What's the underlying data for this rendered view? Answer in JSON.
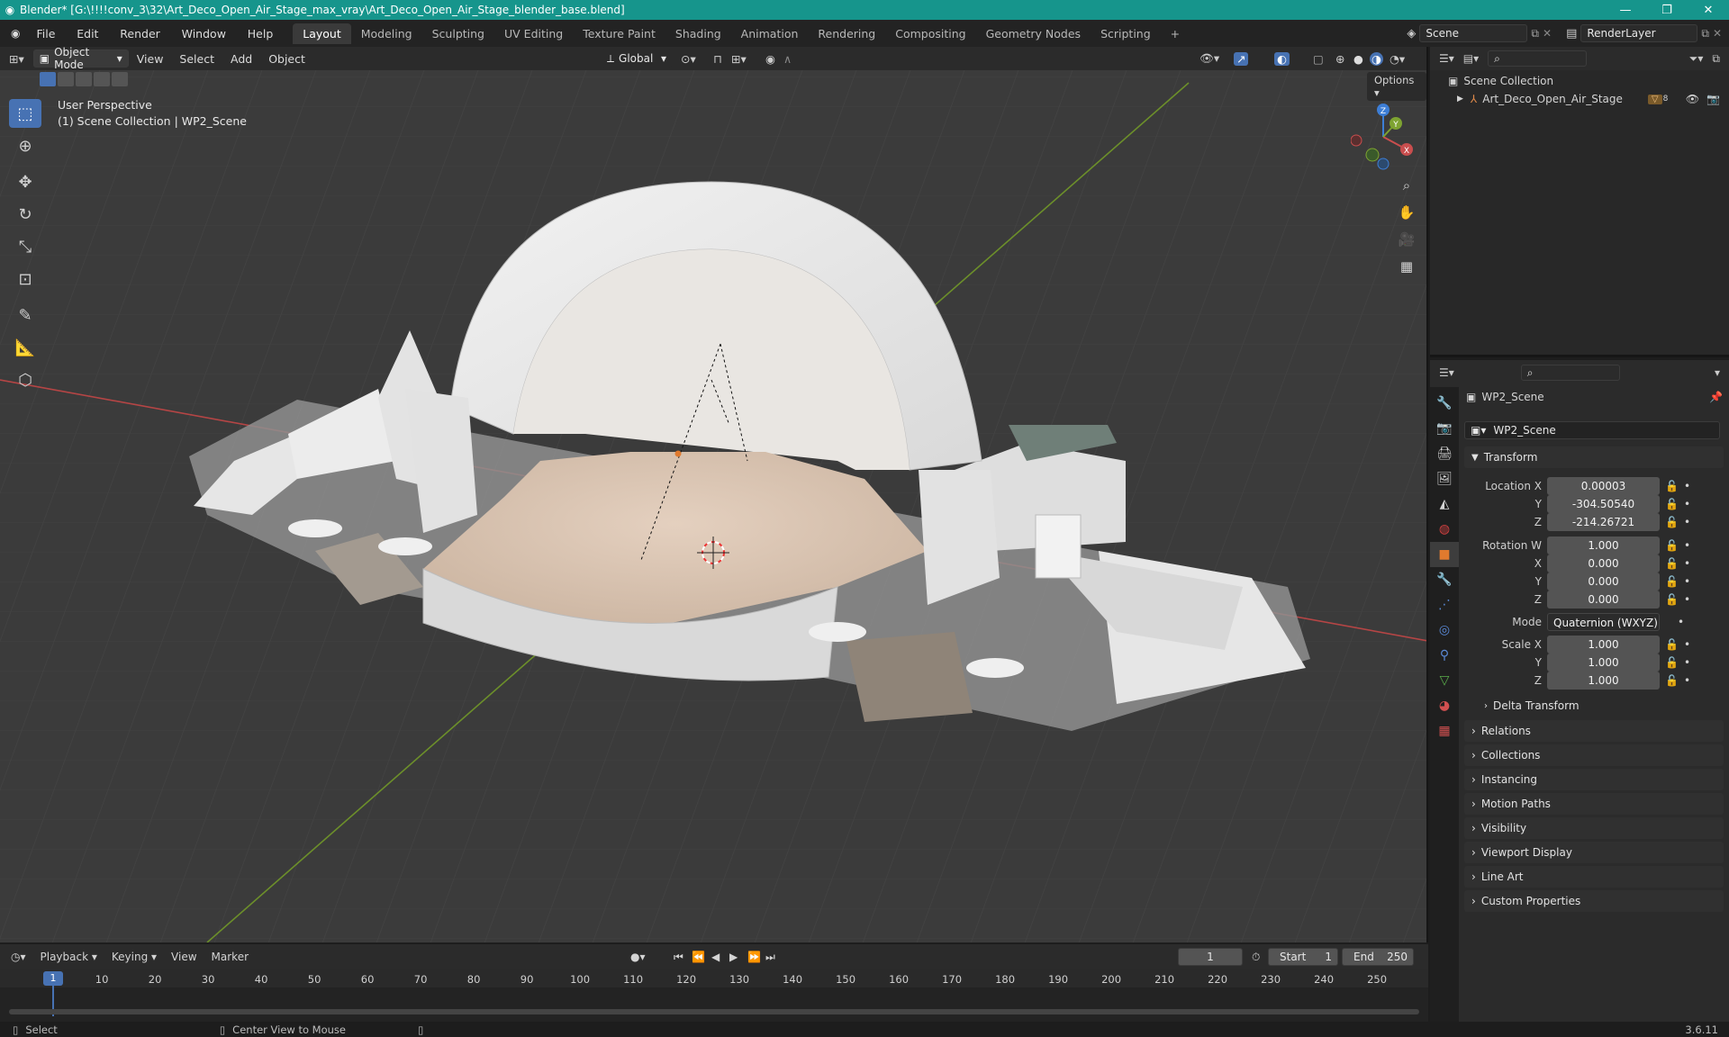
{
  "window": {
    "title": "Blender* [G:\\!!!!conv_3\\32\\Art_Deco_Open_Air_Stage_max_vray\\Art_Deco_Open_Air_Stage_blender_base.blend]",
    "minimize": "—",
    "maximize": "❐",
    "close": "✕"
  },
  "menu": [
    "File",
    "Edit",
    "Render",
    "Window",
    "Help"
  ],
  "workspaces": [
    "Layout",
    "Modeling",
    "Sculpting",
    "UV Editing",
    "Texture Paint",
    "Shading",
    "Animation",
    "Rendering",
    "Compositing",
    "Geometry Nodes",
    "Scripting"
  ],
  "active_workspace": "Layout",
  "scene": {
    "name": "Scene",
    "render_layer": "RenderLayer"
  },
  "viewport": {
    "mode": "Object Mode",
    "menus": [
      "View",
      "Select",
      "Add",
      "Object"
    ],
    "orientation": "Global",
    "options": "Options",
    "perspective": "User Perspective",
    "collection_info": "(1) Scene Collection | WP2_Scene",
    "gizmo": {
      "x": "X",
      "y": "Y",
      "z": "Z"
    }
  },
  "outliner": {
    "root": "Scene Collection",
    "items": [
      {
        "name": "Art_Deco_Open_Air_Stage",
        "badge": "8"
      }
    ]
  },
  "properties": {
    "object_name": "WP2_Scene",
    "data_name": "WP2_Scene",
    "transform": {
      "header": "Transform",
      "location_label": "Location X",
      "location": [
        "0.00003",
        "-304.50540",
        "-214.26721"
      ],
      "rotation_label": "Rotation W",
      "rotation": [
        "1.000",
        "0.000",
        "0.000",
        "0.000"
      ],
      "mode_label": "Mode",
      "mode": "Quaternion (WXYZ)",
      "scale_label": "Scale X",
      "scale": [
        "1.000",
        "1.000",
        "1.000"
      ],
      "axis_y": "Y",
      "axis_z": "Z",
      "axis_x": "X",
      "delta": "Delta Transform"
    },
    "panels": [
      "Relations",
      "Collections",
      "Instancing",
      "Motion Paths",
      "Visibility",
      "Viewport Display",
      "Line Art",
      "Custom Properties"
    ]
  },
  "timeline": {
    "menus": [
      "Playback",
      "Keying",
      "View",
      "Marker"
    ],
    "current_frame": "1",
    "start_label": "Start",
    "start": "1",
    "end_label": "End",
    "end": "250",
    "ruler": [
      "1",
      "10",
      "20",
      "30",
      "40",
      "50",
      "60",
      "70",
      "80",
      "90",
      "100",
      "110",
      "120",
      "130",
      "140",
      "150",
      "160",
      "170",
      "180",
      "190",
      "200",
      "210",
      "220",
      "230",
      "240",
      "250"
    ]
  },
  "status": {
    "select": "Select",
    "center": "Center View to Mouse",
    "version": "3.6.11"
  },
  "colors": {
    "accent": "#4772b3",
    "title_bar": "#16958c",
    "x_axis": "#c94e4e",
    "y_axis": "#7ea331",
    "z_axis": "#3d7ed6",
    "object": "#e07a2e"
  }
}
